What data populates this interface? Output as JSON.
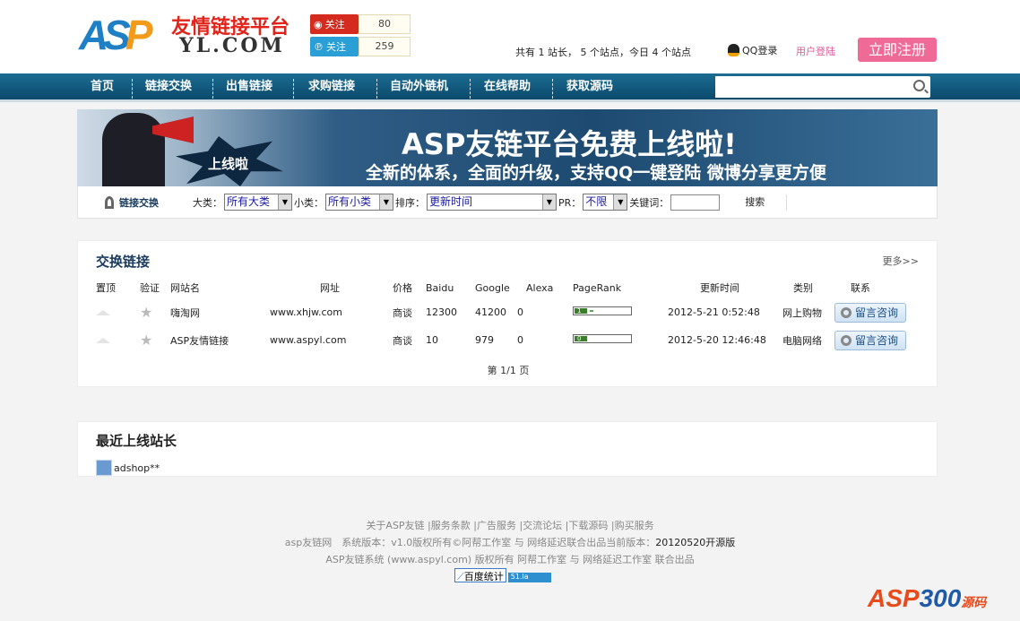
{
  "header": {
    "logo_mark": "ASP",
    "logo_title": "友情链接平台",
    "logo_domain": "YL.COM",
    "weibo": {
      "label": "关注",
      "count": "80"
    },
    "tqq": {
      "label": "关注",
      "count": "259"
    },
    "stats": "共有 1 站长， 5 个站点，今日 4 个站点",
    "qq_login": "QQ登录",
    "user_login": "用户登陆",
    "register": "立即注册"
  },
  "nav": {
    "items": [
      "首页",
      "链接交换",
      "出售链接",
      "求购链接",
      "自动外链机",
      "在线帮助",
      "获取源码"
    ],
    "search_placeholder": ""
  },
  "banner": {
    "badge": "上线啦",
    "headline": "ASP友链平台免费上线啦!",
    "subline": "全新的体系，全面的升级，支持QQ一键登陆 微博分享更方便"
  },
  "filter": {
    "title": "链接交换",
    "cat_label": "大类：",
    "cat_value": "所有大类",
    "sub_label": "小类：",
    "sub_value": "所有小类",
    "sort_label": "排序：",
    "sort_value": "更新时间",
    "pr_label": "PR：",
    "pr_value": "不限",
    "kw_label": "关键词：",
    "search": "搜索"
  },
  "exchange": {
    "title": "交换链接",
    "more": "更多>>",
    "columns": [
      "置顶",
      "验证",
      "网站名",
      "网址",
      "价格",
      "Baidu",
      "Google",
      "Alexa",
      "PageRank",
      "更新时间",
      "类别",
      "联系"
    ],
    "rows": [
      {
        "name": "嗨淘网",
        "url": "www.xhjw.com",
        "price": "商谈",
        "baidu": "12300",
        "google": "41200",
        "alexa": "0",
        "pr": "1",
        "pr_value": 1,
        "updated": "2012-5-21 0:52:48",
        "category": "网上购物",
        "contact": "留言咨询"
      },
      {
        "name": "ASP友情链接",
        "url": "www.aspyl.com",
        "price": "商谈",
        "baidu": "10",
        "google": "979",
        "alexa": "0",
        "pr": "0",
        "pr_value": 0,
        "updated": "2012-5-20 12:46:48",
        "category": "电脑网络",
        "contact": "留言咨询"
      }
    ],
    "pager": "第 1/1 页"
  },
  "recent": {
    "title": "最近上线站长",
    "users": [
      "adshop**"
    ]
  },
  "footer": {
    "links": [
      "关于ASP友链",
      "服务条款",
      "广告服务",
      "交流论坛",
      "下载源码",
      "购买服务"
    ],
    "line2": "asp友链网　系统版本：v1.0版权所有©阿帮工作室 与 网络延迟联合出品当前版本：",
    "line2_version": "20120520开源版",
    "line3": "ASP友链系统 (www.aspyl.com) 版权所有 阿帮工作室 与 网络延迟工作室 联合出品",
    "badge1": "百度统计",
    "badge2": "51.la",
    "watermark": "ASP300",
    "watermark2": "源码"
  }
}
